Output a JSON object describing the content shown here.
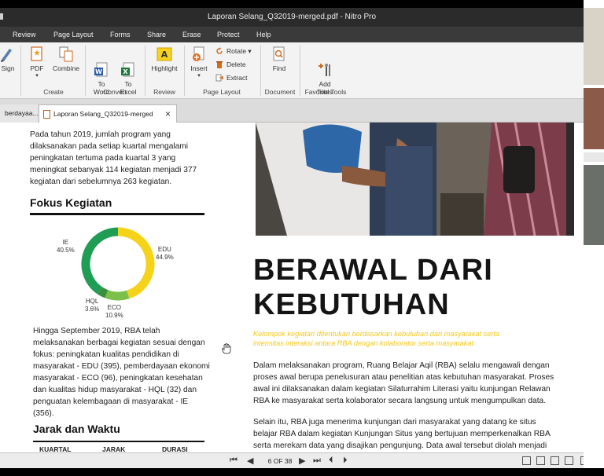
{
  "window": {
    "title": "Laporan Selang_Q32019-merged.pdf - Nitro Pro"
  },
  "menu": [
    "Review",
    "Page Layout",
    "Forms",
    "Share",
    "Erase",
    "Protect",
    "Help"
  ],
  "ribbon": {
    "buttons": {
      "quicksign": "Sign",
      "pdf": "PDF",
      "combine": "Combine",
      "to_word": "To\nWord",
      "to_excel": "To\nExcel",
      "highlight": "Highlight",
      "insert": "Insert",
      "rotate": "Rotate",
      "delete": "Delete",
      "extract": "Extract",
      "find": "Find",
      "add_tools": "Add\nTools"
    },
    "groups": {
      "create": "Create",
      "convert": "Convert",
      "review": "Review",
      "page_layout": "Page Layout",
      "document": "Document",
      "favorite_tools": "Favorite Tools"
    }
  },
  "tabs": {
    "previous": "berdayaa...",
    "active": "Laporan Selang_Q32019-merged"
  },
  "document": {
    "left": {
      "intro": [
        "Pada tahun 2019, jumlah program yang",
        "dilaksanakan pada setiap kuartal mengalami",
        "peningkatan tertuma pada kuartal 3 yang",
        "meningkat sebanyak 114 kegiatan menjadi 377",
        "kegiatan dari sebelumnya 263 kegiatan."
      ],
      "heading_focus": "Fokus Kegiatan",
      "body": [
        "Hingga September 2019, RBA telah",
        "melaksanakan berbagai kegiatan sesuai dengan",
        "fokus: peningkatan kualitas pendidikan di",
        "masyarakat - EDU (395), pemberdayaan ekonomi",
        "masyarakat - ECO (96), peningkatan kesehatan",
        "dan kualitas hidup masyarakat - HQL (32) dan",
        "penguatan kelembagaan di masyarakat - IE",
        "(356)."
      ],
      "heading_time": "Jarak dan Waktu",
      "table_headers": [
        "KUARTAL",
        "JARAK",
        "DURASI"
      ]
    },
    "right": {
      "title_line1": "BERAWAL DARI",
      "title_line2": "KEBUTUHAN",
      "subtitle": [
        "Kelompok kegiatan ditentukan berdasarkan kebutuhan dari masyarakat serta",
        "intensitas interaksi antara RBA dengan kolaborator serta masyarakat"
      ],
      "para1": [
        "Dalam melaksanakan program, Ruang Belajar Aqil (RBA) selalu mengawali dengan",
        "proses awal berupa penelusuran atau penelitian atas kebutuhan masyarakat. Proses",
        "awal ini dilaksanakan dalam kegiatan Silaturrahim Literasi yaitu kunjungan Relawan",
        "RBA ke masyarakat serta kolaborator secara langsung untuk mengumpulkan data."
      ],
      "para2": [
        "Selain itu, RBA juga menerima kunjungan dari masyarakat yang datang ke situs",
        "belajar RBA dalam kegiatan Kunjungan Situs yang bertujuan memperkenalkan RBA",
        "serta merekam data yang disajikan pengunjung. Data awal tersebut diolah menjadi"
      ]
    }
  },
  "chart_data": {
    "type": "pie",
    "variant": "donut",
    "categories": [
      "EDU",
      "ECO",
      "HQL",
      "IE"
    ],
    "values": [
      44.9,
      10.9,
      3.6,
      40.5
    ],
    "value_labels": [
      "44.9%",
      "10.9%",
      "3.6%",
      "40.5%"
    ],
    "colors": [
      "#f6d31b",
      "#7cc04a",
      "#3a8f3c",
      "#1f9d55"
    ],
    "title": ""
  },
  "status": {
    "page": "6 OF 38"
  }
}
